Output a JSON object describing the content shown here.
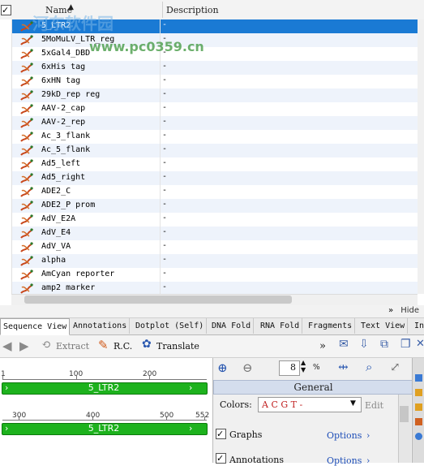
{
  "list": {
    "columns": {
      "name": "Name",
      "description": "Description"
    },
    "rows": [
      {
        "name": "5_LTR2",
        "desc": "-",
        "selected": true
      },
      {
        "name": "5MoMuLV_LTR_reg",
        "desc": "-"
      },
      {
        "name": "5xGal4_DBD",
        "desc": "-"
      },
      {
        "name": "6xHis tag",
        "desc": "-"
      },
      {
        "name": "6xHN tag",
        "desc": "-"
      },
      {
        "name": "29kD_rep reg",
        "desc": "-"
      },
      {
        "name": "AAV-2_cap",
        "desc": "-"
      },
      {
        "name": "AAV-2_rep",
        "desc": "-"
      },
      {
        "name": "Ac_3_flank",
        "desc": "-"
      },
      {
        "name": "Ac_5_flank",
        "desc": "-"
      },
      {
        "name": "Ad5_left",
        "desc": "-"
      },
      {
        "name": "Ad5_right",
        "desc": "-"
      },
      {
        "name": "ADE2_C",
        "desc": "-"
      },
      {
        "name": "ADE2_P prom",
        "desc": "-"
      },
      {
        "name": "AdV_E2A",
        "desc": "-"
      },
      {
        "name": "AdV_E4",
        "desc": "-"
      },
      {
        "name": "AdV_VA",
        "desc": "-"
      },
      {
        "name": "alpha",
        "desc": "-"
      },
      {
        "name": "AmCyan reporter",
        "desc": "-"
      },
      {
        "name": "amp2 marker",
        "desc": "-"
      }
    ]
  },
  "watermark": {
    "line1": "河东软件园",
    "line2": "www.pc0359.cn"
  },
  "hide_label": "Hide",
  "tabs": [
    "Sequence View",
    "Annotations",
    "Dotplot (Self)",
    "DNA Fold",
    "RNA Fold",
    "Fragments",
    "Text View",
    "In"
  ],
  "toolbar": {
    "extract": "Extract",
    "rc": "R.C.",
    "translate": "Translate",
    "zoom_value": "8",
    "zoom_unit": "%"
  },
  "sequence": {
    "row1_ticks": [
      "1",
      "100",
      "200"
    ],
    "row2_ticks": [
      "300",
      "400",
      "500",
      "552"
    ],
    "feature_name": "5_LTR2"
  },
  "side": {
    "general": "General",
    "colors_label": "Colors:",
    "colors_value": "A C G T -",
    "edit": "Edit",
    "graphs": "Graphs",
    "annotations": "Annotations",
    "options": "Options"
  },
  "colors": {
    "selection": "#1a7ad4",
    "feature": "#1db21d",
    "link": "#1f4fb8"
  }
}
